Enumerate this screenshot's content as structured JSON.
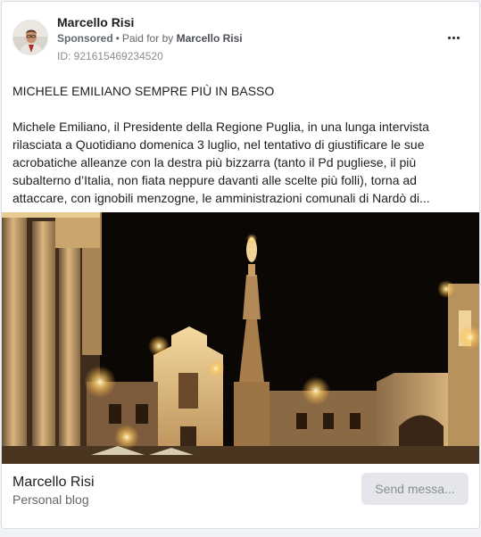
{
  "ad": {
    "page_name": "Marcello Risi",
    "sponsored_label": "Sponsored",
    "separator": "•",
    "paid_for_label": "Paid for by",
    "payer": "Marcello Risi",
    "ad_id": "ID: 921615469234520",
    "more_icon": "ellipsis-horizontal-icon"
  },
  "post": {
    "headline": "MICHELE EMILIANO SEMPRE PIÙ IN BASSO",
    "body": "Michele Emiliano, il Presidente della Regione Puglia, in una lunga intervista rilasciata a Quotidiano domenica 3 luglio, nel tentativo di giustificare le sue acrobatiche alleanze con la destra più bizzarra (tanto il Pd pugliese, il più subalterno d’Italia, non fiata neppure davanti alle scelte più folli), torna ad attaccare, con ignobili menzogne, le amministrazioni comunali di Nardò di..."
  },
  "footer": {
    "title": "Marcello Risi",
    "subtitle": "Personal blog",
    "cta_label": "Send messa..."
  },
  "colors": {
    "background": "#f0f2f5",
    "card": "#ffffff",
    "text_primary": "#1c1e21",
    "text_secondary": "#65676b",
    "button_disabled_bg": "#e4e6eb",
    "button_disabled_text": "#8a8d91"
  }
}
